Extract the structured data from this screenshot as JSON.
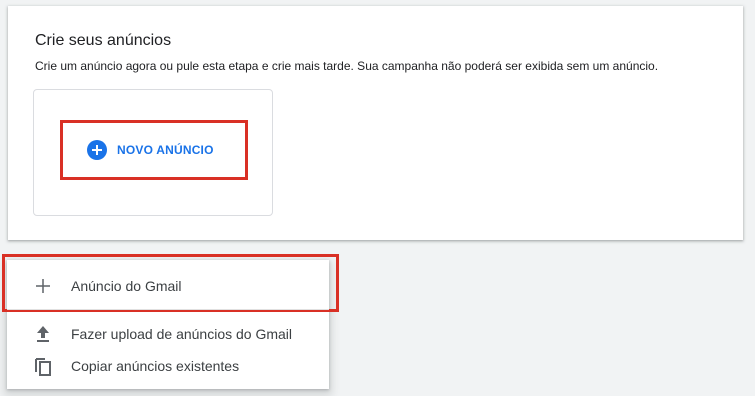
{
  "create_ads": {
    "title": "Crie seus anúncios",
    "description": "Crie um anúncio agora ou pule esta etapa e crie mais tarde. Sua campanha não poderá ser exibida sem um anúncio.",
    "new_ad_label": "NOVO ANÚNCIO"
  },
  "menu": {
    "items": [
      {
        "label": "Anúncio do Gmail",
        "icon": "plus-icon"
      },
      {
        "label": "Fazer upload de anúncios do Gmail",
        "icon": "upload-icon"
      },
      {
        "label": "Copiar anúncios existentes",
        "icon": "copy-icon"
      }
    ]
  },
  "colors": {
    "accent": "#1a73e8",
    "highlight": "#d93025",
    "text": "#202124",
    "icon": "#5f6368"
  }
}
